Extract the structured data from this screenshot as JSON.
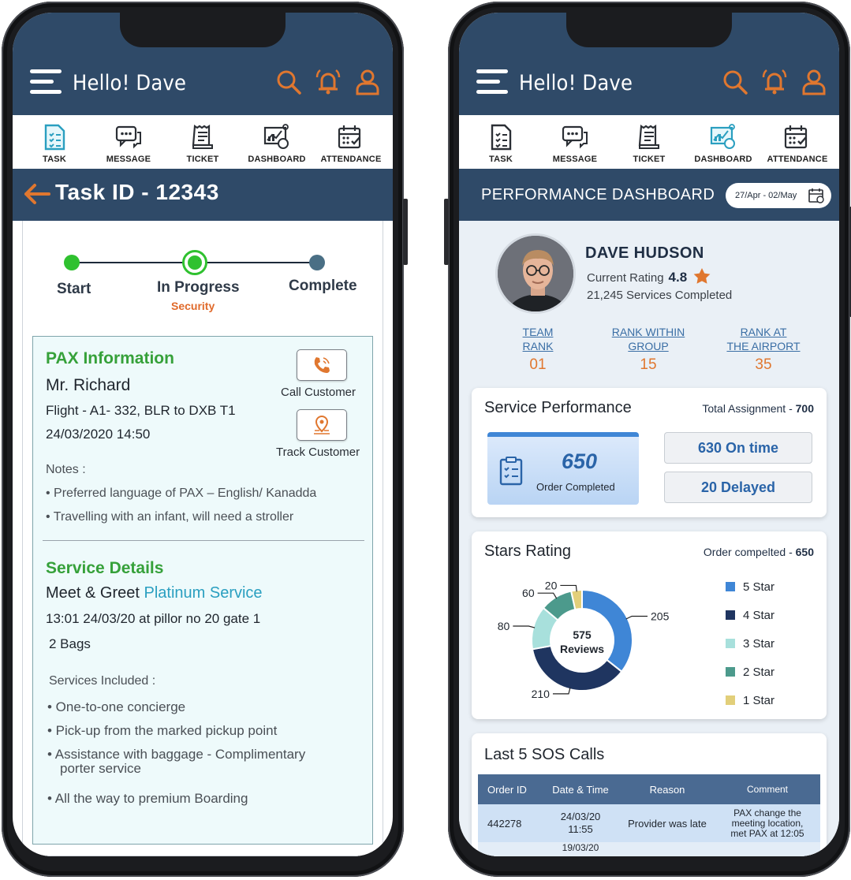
{
  "header": {
    "greeting": "Hello! Dave"
  },
  "nav": {
    "task": "TASK",
    "message": "MESSAGE",
    "ticket": "TICKET",
    "dashboard": "DASHBOARD",
    "attendance": "ATTENDANCE"
  },
  "task": {
    "title": "Task ID - 12343",
    "steps": {
      "start": "Start",
      "in_progress": "In Progress",
      "in_progress_sub": "Security",
      "complete": "Complete"
    },
    "pax": {
      "heading": "PAX Information",
      "name": "Mr. Richard",
      "flight": "Flight - A1- 332, BLR to DXB T1",
      "datetime": "24/03/2020 14:50",
      "call_label": "Call Customer",
      "track_label": "Track Customer",
      "notes_label": "Notes :",
      "notes": [
        "• Preferred language of PAX – English/ Kanadda",
        "• Travelling with an infant, will need a stroller"
      ]
    },
    "service": {
      "heading": "Service Details",
      "type": "Meet & Greet",
      "tier": "Platinum Service",
      "when": "13:01 24/03/20 at pillor no 20 gate 1",
      "bags": "2 Bags",
      "included_label": "Services Included :",
      "included": [
        "• One-to-one concierge",
        "• Pick-up from the marked pickup point",
        "• Assistance with baggage - Complimentary",
        "porter service",
        "• All the way to premium Boarding"
      ]
    }
  },
  "dashboard": {
    "title": "PERFORMANCE DASHBOARD",
    "date_range": "27/Apr - 02/May",
    "profile": {
      "name": "DAVE HUDSON",
      "rating_label": "Current Rating",
      "rating": "4.8",
      "services": "21,245 Services Completed"
    },
    "ranks": [
      {
        "line1": "TEAM",
        "line2": "RANK",
        "value": "01"
      },
      {
        "line1": "RANK WITHIN",
        "line2": "GROUP",
        "value": "15"
      },
      {
        "line1": "RANK AT",
        "line2": "THE AIRPORT",
        "value": "35"
      }
    ],
    "service_perf": {
      "title": "Service Performance",
      "total_label": "Total Assignment - ",
      "total": "700",
      "completed": "650",
      "completed_label": "Order Completed",
      "on_time": "630 On time",
      "delayed": "20 Delayed"
    },
    "stars": {
      "title": "Stars Rating",
      "order_label": "Order compelted - ",
      "order_value": "650",
      "center_value": "575",
      "center_label": "Reviews"
    },
    "sos": {
      "title": "Last 5 SOS Calls",
      "columns": [
        "Order ID",
        "Date & Time",
        "Reason",
        "Comment"
      ],
      "rows": [
        {
          "id": "442278",
          "date1": "24/03/20",
          "date2": "11:55",
          "reason": "Provider was late",
          "comment1": "PAX change the",
          "comment2": "meeting location,",
          "comment3": "met PAX at 12:05"
        },
        {
          "id": "",
          "date1": "19/03/20",
          "reason": "",
          "comment1": ""
        }
      ]
    }
  },
  "chart_data": {
    "type": "pie",
    "categories": [
      "5 Star",
      "4 Star",
      "3 Star",
      "2 Star",
      "1 Star"
    ],
    "values": [
      205,
      210,
      80,
      60,
      20
    ],
    "colors": [
      "#3f86d6",
      "#1f3560",
      "#a8e0dc",
      "#4c9a8c",
      "#e2cf7a"
    ],
    "title": "Stars Rating",
    "legend": "right"
  },
  "colors": {
    "navy": "#2f4a68",
    "orange": "#e0772f",
    "green": "#36a13a",
    "teal": "#2a9fc0"
  }
}
